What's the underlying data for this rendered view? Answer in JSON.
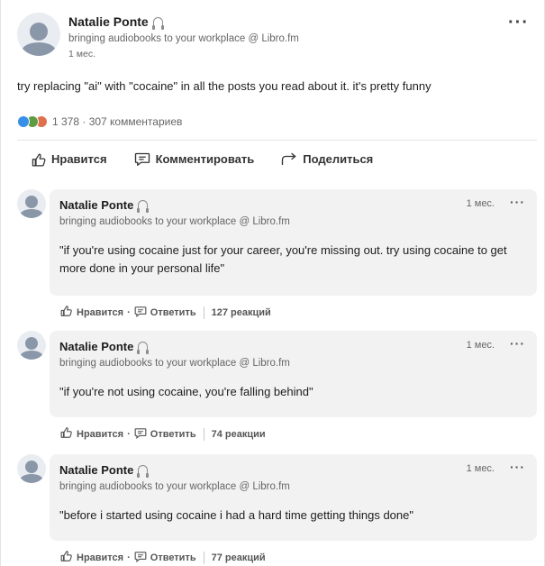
{
  "post": {
    "author": "Natalie Ponte",
    "tagline": "bringing audiobooks to your workplace @ Libro.fm",
    "time": "1 мес.",
    "text": "try replacing \"ai\" with \"cocaine\" in all the posts you read about it. it's pretty funny",
    "stats": "1 378 · 307 комментариев",
    "more_icon": "ellipsis-icon"
  },
  "actions": {
    "like": "Нравится",
    "comment": "Комментировать",
    "share": "Поделиться"
  },
  "comments": [
    {
      "author": "Natalie Ponte",
      "tagline": "bringing audiobooks to your workplace @ Libro.fm",
      "time": "1 мес.",
      "text": "\"if you're using cocaine just for your career, you're missing out. try using cocaine to get more done in your personal life\"",
      "like": "Нравится",
      "reply": "Ответить",
      "reactions": "127 реакций"
    },
    {
      "author": "Natalie Ponte",
      "tagline": "bringing audiobooks to your workplace @ Libro.fm",
      "time": "1 мес.",
      "text": "\"if you're not using cocaine, you're falling behind\"",
      "like": "Нравится",
      "reply": "Ответить",
      "reactions": "74 реакции"
    },
    {
      "author": "Natalie Ponte",
      "tagline": "bringing audiobooks to your workplace @ Libro.fm",
      "time": "1 мес.",
      "text": "\"before i started using cocaine i had a hard time getting things done\"",
      "like": "Нравится",
      "reply": "Ответить",
      "reactions": "77 реакций"
    }
  ],
  "colors": {
    "reaction_like": "#378fe9",
    "reaction_celebrate": "#5f9b41",
    "reaction_love": "#df704d",
    "bubble_bg": "#f2f2f2"
  }
}
